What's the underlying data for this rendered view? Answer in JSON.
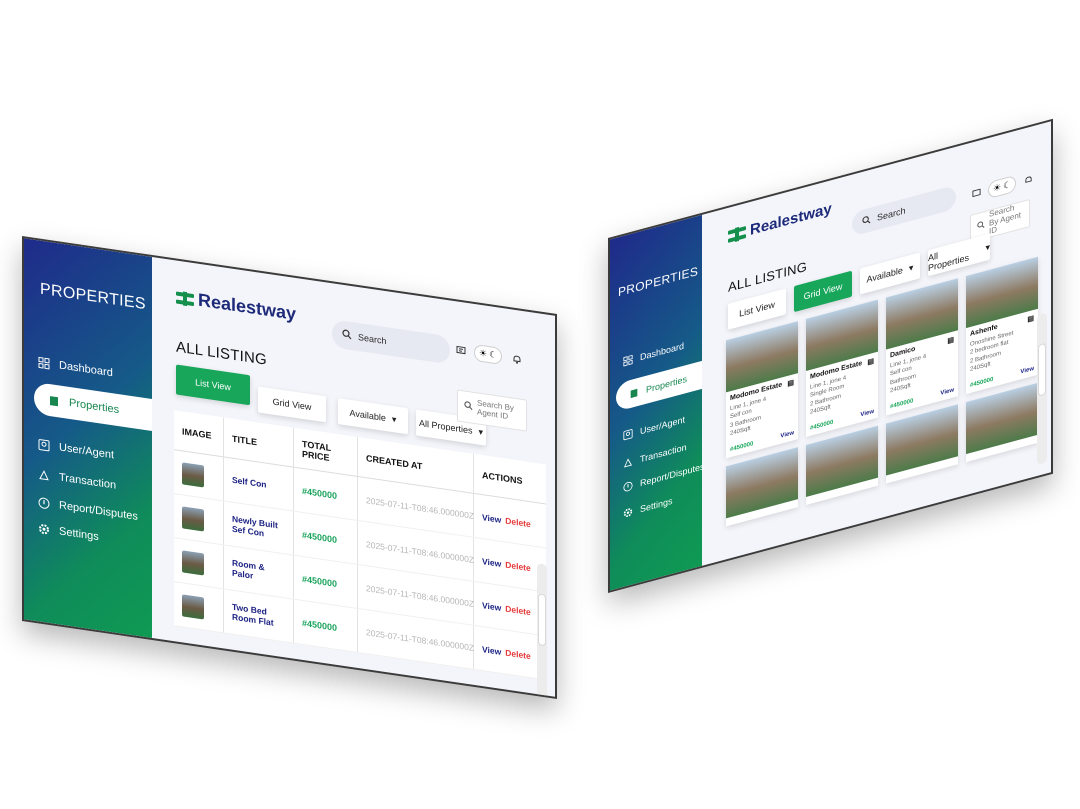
{
  "left": {
    "sidebar": {
      "title": "PROPERTIES",
      "items": [
        {
          "label": "Dashboard",
          "icon": "dashboard-icon"
        },
        {
          "label": "Properties",
          "icon": "building-icon"
        },
        {
          "label": "User/Agent",
          "icon": "user-card-icon"
        },
        {
          "label": "Transaction",
          "icon": "transaction-icon"
        },
        {
          "label": "Report/Disputes",
          "icon": "alert-icon"
        },
        {
          "label": "Settings",
          "icon": "gear-icon"
        }
      ]
    },
    "header": {
      "brand": "Realestway",
      "search_placeholder": "Search",
      "chat_icon": "▤",
      "sun_icon": "☀",
      "moon_icon": "☾",
      "bell_icon": "🔔"
    },
    "main": {
      "title": "ALL LISTING",
      "list_view_label": "List View",
      "grid_view_label": "Grid View",
      "available_label": "Available",
      "all_properties_label": "All Properties",
      "agent_search_label": "Search By Agent ID"
    },
    "table": {
      "columns": [
        "IMAGE",
        "TITLE",
        "TOTAL PRICE",
        "CREATED AT",
        "ACTIONS"
      ],
      "rows": [
        {
          "title": "Self Con",
          "price": "#450000",
          "created": "2025-07-11-T08:46.000000Z"
        },
        {
          "title": "Newly Built Sef Con",
          "price": "#450000",
          "created": "2025-07-11-T08:46.000000Z"
        },
        {
          "title": "Room & Palor",
          "price": "#450000",
          "created": "2025-07-11-T08:46.000000Z"
        },
        {
          "title": "Two Bed Room Flat",
          "price": "#450000",
          "created": "2025-07-11-T08:46.000000Z"
        }
      ],
      "view_label": "View",
      "delete_label": "Delete"
    }
  },
  "right": {
    "sidebar": {
      "title": "PROPERTIES",
      "items": [
        {
          "label": "Dashboard",
          "icon": "dashboard-icon"
        },
        {
          "label": "Properties",
          "icon": "building-icon"
        },
        {
          "label": "User/Agent",
          "icon": "user-card-icon"
        },
        {
          "label": "Transaction",
          "icon": "transaction-icon"
        },
        {
          "label": "Report/Disputes",
          "icon": "alert-icon"
        },
        {
          "label": "Settings",
          "icon": "gear-icon"
        }
      ]
    },
    "header": {
      "brand": "Realestway",
      "search_placeholder": "Search"
    },
    "main": {
      "title": "ALL LISTING",
      "list_view_label": "List View",
      "grid_view_label": "Grid View",
      "available_label": "Available",
      "all_properties_label": "All Properties",
      "agent_search_label": "Search By Agent ID"
    },
    "cards": [
      {
        "name": "Modomo Estate",
        "addr": "Line 1, jone 4",
        "type": "Self con",
        "bath": "3 Bathroom",
        "size": "240Sqft",
        "price": "#450000",
        "view": "View"
      },
      {
        "name": "Modomo Estate",
        "addr": "Line 1, jone 4",
        "type": "Single Room",
        "bath": "2 Bathroom",
        "size": "240Sqft",
        "price": "#450000",
        "view": "View"
      },
      {
        "name": "Damico",
        "addr": "Line 1, jone 4",
        "type": "Self con",
        "bath": "Bathroom",
        "size": "240Sqft",
        "price": "#450000",
        "view": "View"
      },
      {
        "name": "Ashenfe",
        "addr": "Onoshine Street",
        "type": "2 bedroom flat",
        "bath": "2 Bathroom",
        "size": "240Sqft",
        "price": "#450000",
        "view": "View"
      }
    ]
  }
}
